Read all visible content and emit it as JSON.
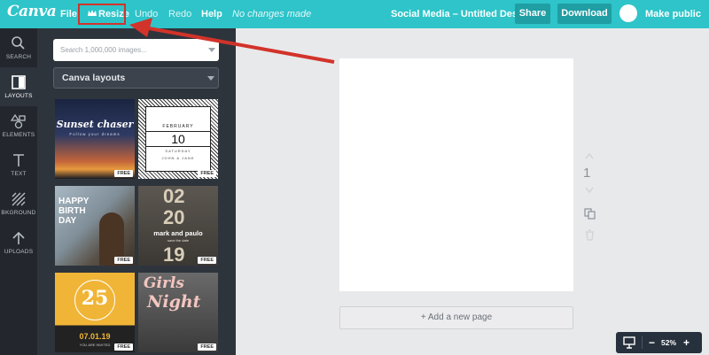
{
  "app": {
    "logo": "Canva",
    "menu": [
      "File",
      "Resize",
      "Undo",
      "Redo",
      "Help"
    ],
    "status": "No changes made",
    "doc_title": "Social Media – Untitled Design",
    "share": "Share",
    "download": "Download",
    "make_public": "Make public"
  },
  "rail": [
    {
      "label": "SEARCH",
      "icon": "search-icon"
    },
    {
      "label": "LAYOUTS",
      "icon": "layouts-icon"
    },
    {
      "label": "ELEMENTS",
      "icon": "elements-icon"
    },
    {
      "label": "TEXT",
      "icon": "text-icon"
    },
    {
      "label": "BKGROUND",
      "icon": "background-icon"
    },
    {
      "label": "UPLOADS",
      "icon": "upload-icon"
    }
  ],
  "panel": {
    "search_placeholder": "Search 1,000,000 images...",
    "dropdown": "Canva layouts",
    "free": "FREE",
    "templates": [
      {
        "lines": [
          "Sunset chaser",
          "Follow your dreams"
        ]
      },
      {
        "lines": [
          "FEBRUARY",
          "10",
          "SATURDAY",
          "JOHN & JANE"
        ]
      },
      {
        "lines": [
          "HAPPY",
          "BIRTH",
          "DAY"
        ]
      },
      {
        "lines": [
          "02",
          "20",
          "19",
          "mark and paulo",
          "save the date"
        ]
      },
      {
        "lines": [
          "25",
          "07.01.19",
          "YOU ARE INVITED"
        ]
      },
      {
        "lines": [
          "Girls",
          "Night"
        ]
      }
    ]
  },
  "canvas": {
    "page_number": "1",
    "add_page": "+ Add a new page",
    "zoom": "52%",
    "zoom_minus": "−",
    "zoom_plus": "+"
  },
  "colors": {
    "topbar": "#2ec4c9",
    "button": "#1f9ea3",
    "rail": "#23272d",
    "panel": "#2e343c",
    "annotation": "#d2332a"
  }
}
